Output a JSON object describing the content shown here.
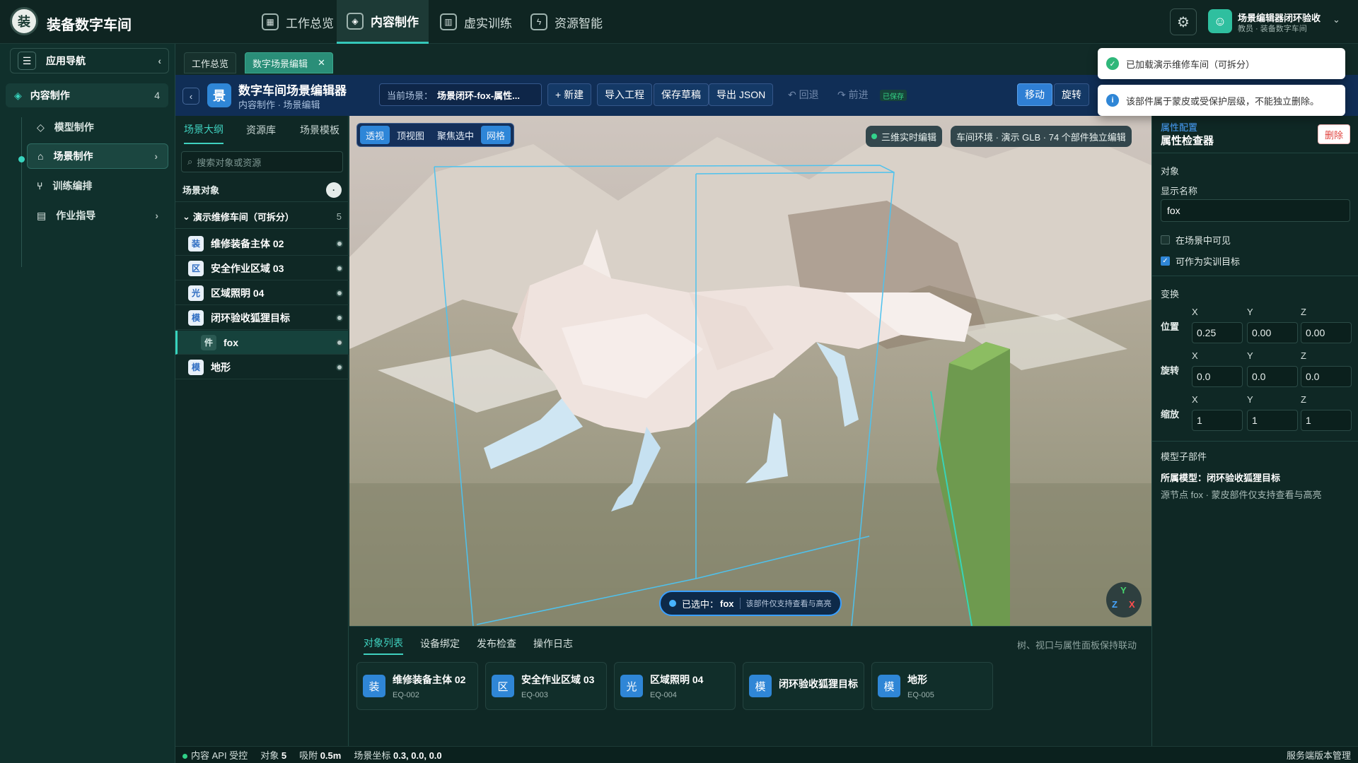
{
  "app": {
    "name": "装备数字车间",
    "logo_text": "装"
  },
  "topnav": [
    {
      "label": "工作总览",
      "icon": "grid-icon"
    },
    {
      "label": "内容制作",
      "icon": "cube-icon",
      "active": true
    },
    {
      "label": "虚实训练",
      "icon": "book-icon"
    },
    {
      "label": "资源智能",
      "icon": "plug-icon"
    }
  ],
  "user": {
    "name": "场景编辑器闭环验收",
    "role": "教员 · 装备数字车间"
  },
  "sidebar": {
    "title": "应用导航",
    "group": {
      "label": "内容制作",
      "count": "4"
    },
    "items": [
      {
        "label": "模型制作"
      },
      {
        "label": "场景制作",
        "active": true
      },
      {
        "label": "训练编排"
      },
      {
        "label": "作业指导"
      }
    ]
  },
  "tabs": [
    {
      "label": "工作总览"
    },
    {
      "label": "数字场景编辑",
      "active": true
    }
  ],
  "editor": {
    "logo": "景",
    "title": "数字车间场景编辑器",
    "subtitle": "内容制作 · 场景编辑",
    "scene_label": "当前场景：",
    "scene_value": "场景闭环-fox-属性...",
    "buttons": {
      "new": "+ 新建",
      "import": "导入工程",
      "save": "保存草稿",
      "export": "导出 JSON",
      "undo": "↶ 回退",
      "redo": "↷ 前进",
      "saved": "已保存"
    },
    "transform": {
      "move": "移动",
      "rotate": "旋转"
    }
  },
  "left_panel": {
    "tabs": [
      "场景大纲",
      "资源库",
      "场景模板"
    ],
    "search_placeholder": "搜索对象或资源",
    "section_title": "场景对象",
    "root": {
      "label": "演示维修车间（可拆分）",
      "count": "5"
    },
    "tree": [
      {
        "badge": "装",
        "label": "维修装备主体 02"
      },
      {
        "badge": "区",
        "label": "安全作业区域 03"
      },
      {
        "badge": "光",
        "label": "区域照明 04"
      },
      {
        "badge": "模",
        "label": "闭环验收狐狸目标"
      },
      {
        "badge": "件",
        "label": "fox",
        "selected": true,
        "child": true
      },
      {
        "badge": "模",
        "label": "地形"
      }
    ]
  },
  "viewport": {
    "view_buttons": [
      "透视",
      "顶视图",
      "聚焦选中",
      "网格"
    ],
    "realtime_badge": "三维实时编辑",
    "env_badge": "车间环境 · 演示 GLB · 74 个部件独立编辑",
    "selected_prefix": "已选中：",
    "selected_name": "fox",
    "selected_hint": "该部件仅支持查看与高亮",
    "gizmo": {
      "y": "Y",
      "z": "Z",
      "x": "X"
    }
  },
  "bottom_panel": {
    "tabs": [
      "对象列表",
      "设备绑定",
      "发布检查",
      "操作日志"
    ],
    "note": "树、视口与属性面板保持联动",
    "cards": [
      {
        "badge": "装",
        "title": "维修装备主体 02",
        "id": "EQ-002"
      },
      {
        "badge": "区",
        "title": "安全作业区域 03",
        "id": "EQ-003"
      },
      {
        "badge": "光",
        "title": "区域照明 04",
        "id": "EQ-004"
      },
      {
        "badge": "模",
        "title": "闭环验收狐狸目标",
        "id": ""
      },
      {
        "badge": "模",
        "title": "地形",
        "id": "EQ-005"
      }
    ]
  },
  "inspector": {
    "link": "属性配置",
    "title": "属性检查器",
    "delete": "删除",
    "object_section": "对象",
    "display_name_label": "显示名称",
    "display_name": "fox",
    "visible_label": "在场景中可见",
    "visible": false,
    "target_label": "可作为实训目标",
    "target": true,
    "transform_section": "变换",
    "axes": [
      "X",
      "Y",
      "Z"
    ],
    "position_label": "位置",
    "position": [
      "0.25",
      "0.00",
      "0.00"
    ],
    "rotation_label": "旋转",
    "rotation": [
      "0.0",
      "0.0",
      "0.0"
    ],
    "scale_label": "缩放",
    "scale": [
      "1",
      "1",
      "1"
    ],
    "sub_section": "模型子部件",
    "parent_model": "所属模型：闭环验收狐狸目标",
    "sub_note": "源节点 fox · 蒙皮部件仅支持查看与高亮"
  },
  "toasts": [
    {
      "text": "已加载演示维修车间（可拆分）",
      "type": "success",
      "color": "#2fb77a"
    },
    {
      "text": "该部件属于蒙皮或受保护层级，不能独立删除。",
      "type": "info",
      "color": "#2f86d6"
    }
  ],
  "statusbar": {
    "api": "内容 API 受控",
    "objects_label": "对象",
    "objects": "5",
    "snap_label": "吸附",
    "snap": "0.5m",
    "coords_label": "场景坐标",
    "coords": "0.3, 0.0, 0.0",
    "right": "服务端版本管理"
  },
  "colors": {
    "accent": "#35c7ba",
    "primary_blue": "#2f86d6",
    "toolbar_blue": "#102e56",
    "bg": "#0f2a27"
  }
}
